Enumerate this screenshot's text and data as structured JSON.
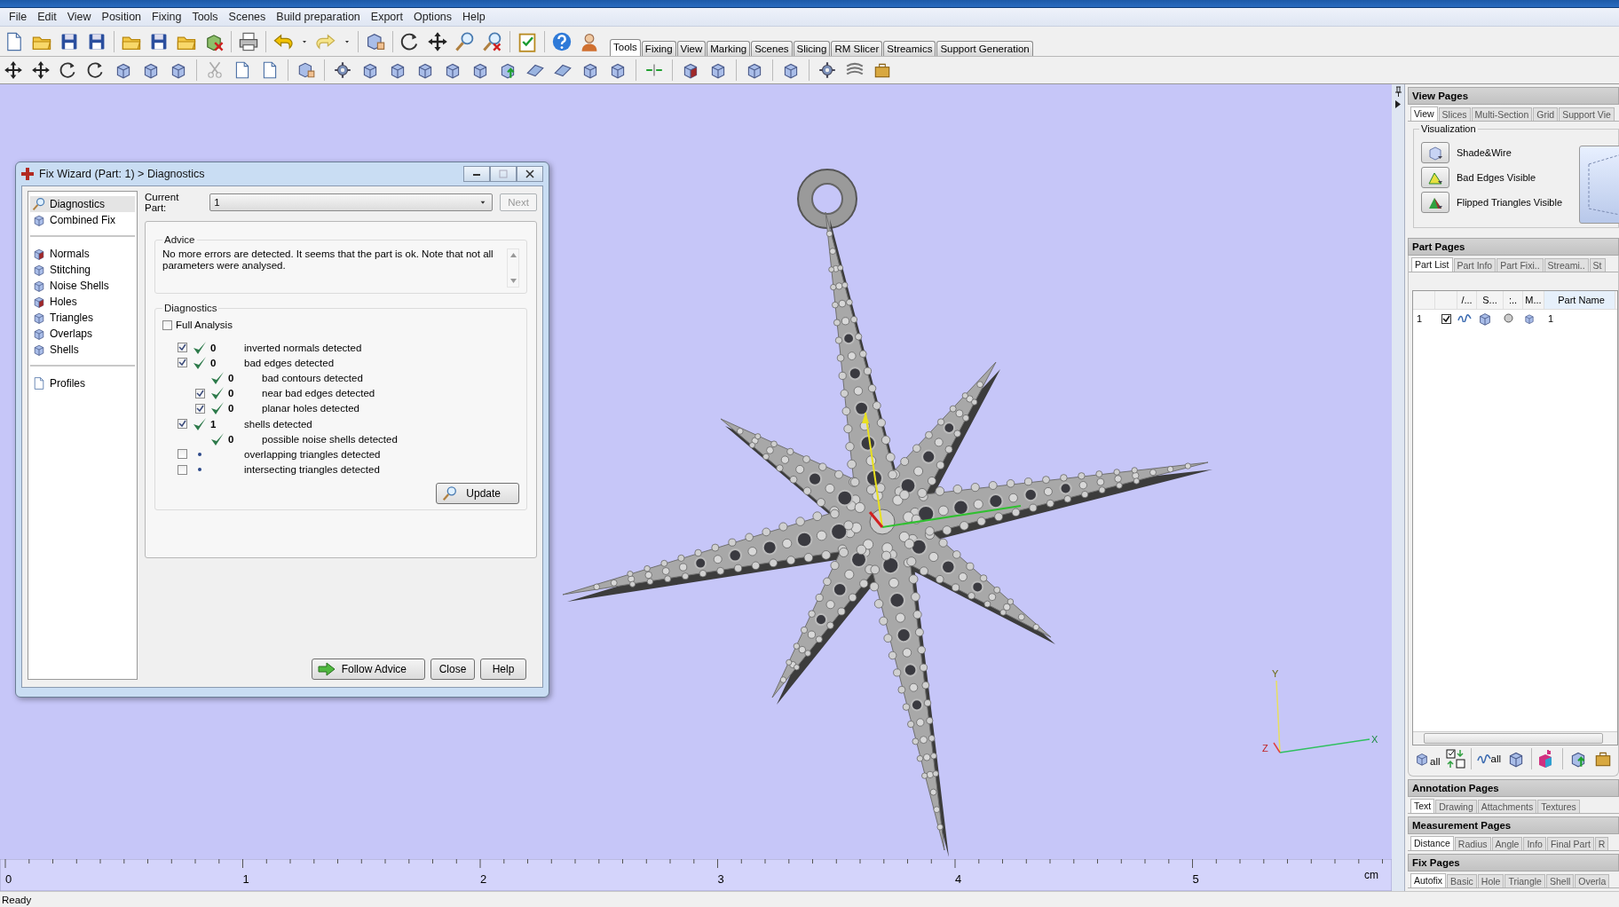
{
  "menu": [
    "File",
    "Edit",
    "View",
    "Position",
    "Fixing",
    "Tools",
    "Scenes",
    "Build preparation",
    "Export",
    "Options",
    "Help"
  ],
  "ribbon_tabs": [
    {
      "label": "Tools",
      "selected": true
    },
    {
      "label": "Fixing",
      "selected": false
    },
    {
      "label": "View",
      "selected": false
    },
    {
      "label": "Marking",
      "selected": false
    },
    {
      "label": "Scenes",
      "selected": false
    },
    {
      "label": "Slicing",
      "selected": false
    },
    {
      "label": "RM Slicer",
      "selected": false
    },
    {
      "label": "Streamics",
      "selected": false
    },
    {
      "label": "Support Generation",
      "selected": false
    }
  ],
  "fix_wizard": {
    "title": "Fix Wizard (Part: 1) > Diagnostics",
    "nav": [
      {
        "items": [
          {
            "label": "Diagnostics",
            "selected": true
          },
          {
            "label": "Combined Fix",
            "selected": false
          }
        ]
      },
      {
        "items": [
          {
            "label": "Normals",
            "selected": false
          },
          {
            "label": "Stitching",
            "selected": false
          },
          {
            "label": "Noise Shells",
            "selected": false
          },
          {
            "label": "Holes",
            "selected": false
          },
          {
            "label": "Triangles",
            "selected": false
          },
          {
            "label": "Overlaps",
            "selected": false
          },
          {
            "label": "Shells",
            "selected": false
          }
        ]
      },
      {
        "items": [
          {
            "label": "Profiles",
            "selected": false
          }
        ]
      }
    ],
    "current_part": {
      "label": "Current Part:",
      "value": "1"
    },
    "next_button": {
      "label": "Next",
      "disabled": true
    },
    "advice": {
      "title": "Advice",
      "text": "No more errors are detected. It seems that the part is ok. Note that not all parameters were analysed."
    },
    "diagnostics": {
      "title": "Diagnostics",
      "full_analysis": {
        "label": "Full Analysis",
        "checked": false
      },
      "rows": [
        {
          "kind": "check",
          "checked": true,
          "passed": true,
          "count": "0",
          "label": "inverted normals detected"
        },
        {
          "kind": "check",
          "checked": true,
          "passed": true,
          "count": "0",
          "label": "bad edges detected",
          "children": [
            {
              "kind": "info",
              "passed": true,
              "count": "0",
              "label": "bad contours detected"
            },
            {
              "kind": "check",
              "checked": true,
              "passed": true,
              "count": "0",
              "label": "near bad edges detected"
            },
            {
              "kind": "check",
              "checked": true,
              "passed": true,
              "count": "0",
              "label": "planar holes detected"
            }
          ]
        },
        {
          "kind": "check",
          "checked": true,
          "passed": true,
          "count": "1",
          "label": "shells detected",
          "children": [
            {
              "kind": "info",
              "passed": true,
              "count": "0",
              "label": "possible noise shells detected"
            }
          ]
        },
        {
          "kind": "check",
          "checked": false,
          "passed": false,
          "label": "overlapping triangles detected"
        },
        {
          "kind": "check",
          "checked": false,
          "passed": false,
          "label": "intersecting triangles detected"
        }
      ]
    },
    "update_button": "Update",
    "buttons": [
      "Follow Advice",
      "Close",
      "Help"
    ]
  },
  "viewport": {
    "triad": {
      "x": "X",
      "y": "Y",
      "z": "Z"
    },
    "ruler": {
      "labels": [
        "0",
        "1",
        "2",
        "3",
        "4",
        "5"
      ],
      "unit": "cm"
    }
  },
  "side_panel": {
    "view_pages": {
      "title": "View Pages",
      "tabs": [
        {
          "label": "View",
          "selected": true
        },
        {
          "label": "Slices",
          "selected": false
        },
        {
          "label": "Multi-Section",
          "selected": false
        },
        {
          "label": "Grid",
          "selected": false
        },
        {
          "label": "Support Vie",
          "selected": false
        }
      ],
      "group": "Visualization",
      "options": [
        "Shade&Wire",
        "Bad Edges Visible",
        "Flipped Triangles Visible"
      ]
    },
    "part_pages": {
      "title": "Part Pages",
      "tabs": [
        {
          "label": "Part List",
          "selected": true
        },
        {
          "label": "Part Info",
          "selected": false
        },
        {
          "label": "Part Fixi..",
          "selected": false
        },
        {
          "label": "Streami..",
          "selected": false
        },
        {
          "label": "St",
          "selected": false
        }
      ],
      "columns": [
        "/...",
        "S...",
        ":..",
        "M...",
        "Part Name"
      ],
      "rows": [
        {
          "index": "1",
          "checked": true,
          "name": "1"
        }
      ],
      "tool_labels": [
        "all",
        "all"
      ]
    },
    "annotation_pages": {
      "title": "Annotation Pages",
      "tabs": [
        {
          "label": "Text",
          "selected": true
        },
        {
          "label": "Drawing",
          "selected": false
        },
        {
          "label": "Attachments",
          "selected": false
        },
        {
          "label": "Textures",
          "selected": false
        }
      ]
    },
    "measurement_pages": {
      "title": "Measurement Pages",
      "tabs": [
        {
          "label": "Distance",
          "selected": true
        },
        {
          "label": "Radius",
          "selected": false
        },
        {
          "label": "Angle",
          "selected": false
        },
        {
          "label": "Info",
          "selected": false
        },
        {
          "label": "Final Part",
          "selected": false
        },
        {
          "label": "R",
          "selected": false
        }
      ]
    },
    "fix_pages": {
      "title": "Fix Pages",
      "tabs": [
        {
          "label": "Autofix",
          "selected": true
        },
        {
          "label": "Basic",
          "selected": false
        },
        {
          "label": "Hole",
          "selected": false
        },
        {
          "label": "Triangle",
          "selected": false
        },
        {
          "label": "Shell",
          "selected": false
        },
        {
          "label": "Overla",
          "selected": false
        }
      ]
    }
  },
  "status_bar": "Ready"
}
